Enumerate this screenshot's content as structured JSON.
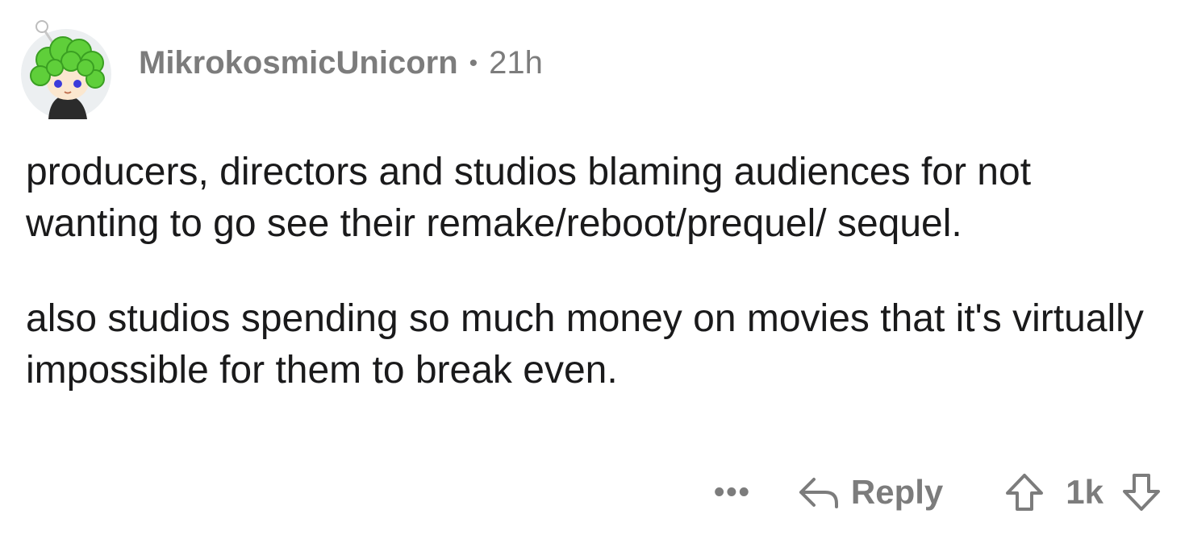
{
  "comment": {
    "username": "MikrokosmicUnicorn",
    "separator": "•",
    "timestamp": "21h",
    "paragraphs": [
      "producers, directors and studios blaming audiences for not wanting to go see their remake/reboot/prequel/ sequel.",
      "also studios spending so much money on movies that it's virtually impossible for them to break even."
    ],
    "actions": {
      "more_label": "•••",
      "reply_label": "Reply",
      "score": "1k"
    },
    "icons": {
      "avatar": "avatar-icon",
      "reply": "reply-arrow-icon",
      "upvote": "upvote-arrow-icon",
      "downvote": "downvote-arrow-icon"
    },
    "colors": {
      "meta": "#7c7c7c",
      "text": "#1a1a1b",
      "avatar_hair": "#5fcf3a"
    }
  }
}
